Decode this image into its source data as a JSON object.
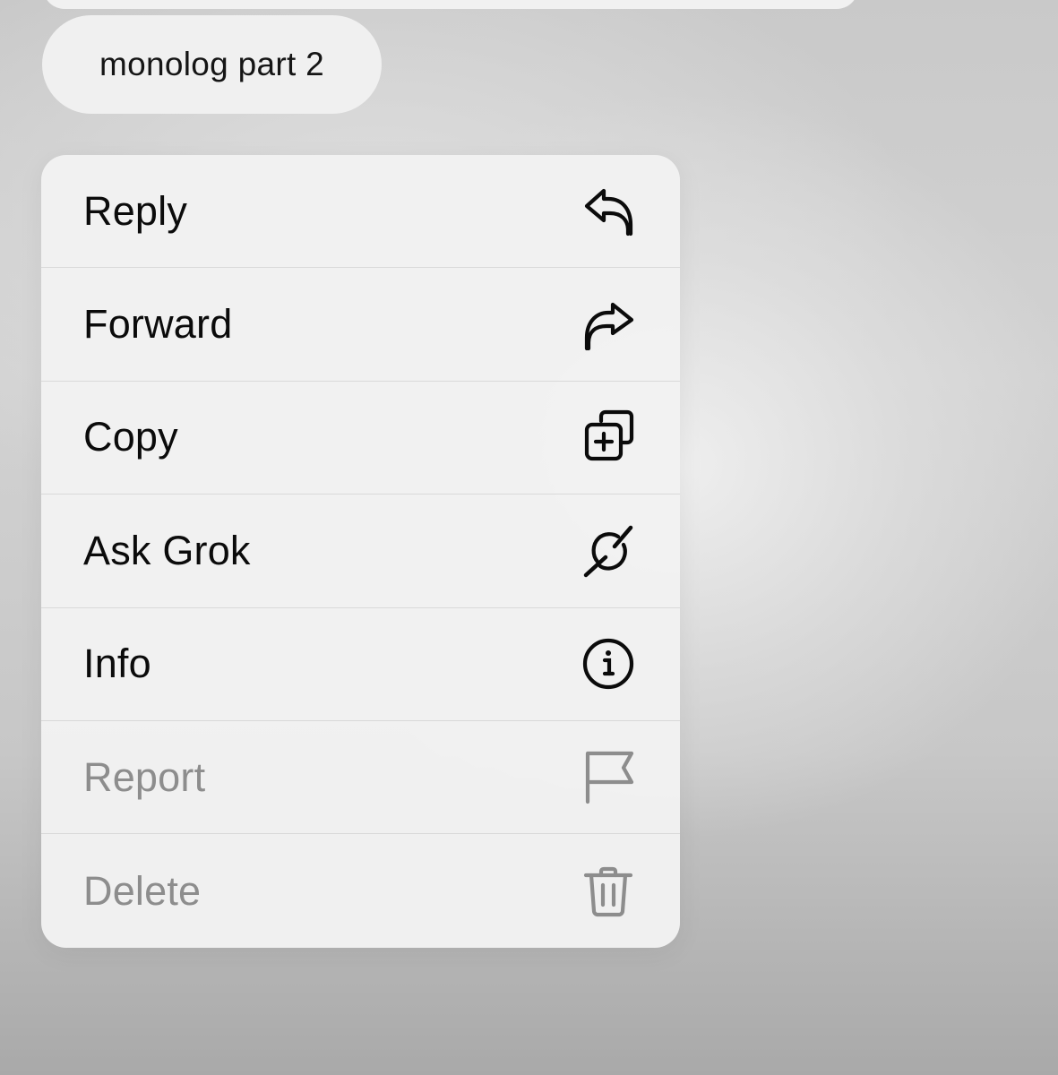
{
  "message": {
    "text": "monolog part 2"
  },
  "menu": {
    "items": [
      {
        "label": "Reply",
        "icon": "reply-icon",
        "disabled": false
      },
      {
        "label": "Forward",
        "icon": "forward-icon",
        "disabled": false
      },
      {
        "label": "Copy",
        "icon": "copy-icon",
        "disabled": false
      },
      {
        "label": "Ask Grok",
        "icon": "grok-icon",
        "disabled": false
      },
      {
        "label": "Info",
        "icon": "info-icon",
        "disabled": false
      },
      {
        "label": "Report",
        "icon": "flag-icon",
        "disabled": true
      },
      {
        "label": "Delete",
        "icon": "trash-icon",
        "disabled": true
      }
    ]
  },
  "colors": {
    "text": "#0b0b0b",
    "disabled_text": "#8d8d8d",
    "menu_background": "#f2f2f2",
    "separator": "#d9d9d9"
  }
}
